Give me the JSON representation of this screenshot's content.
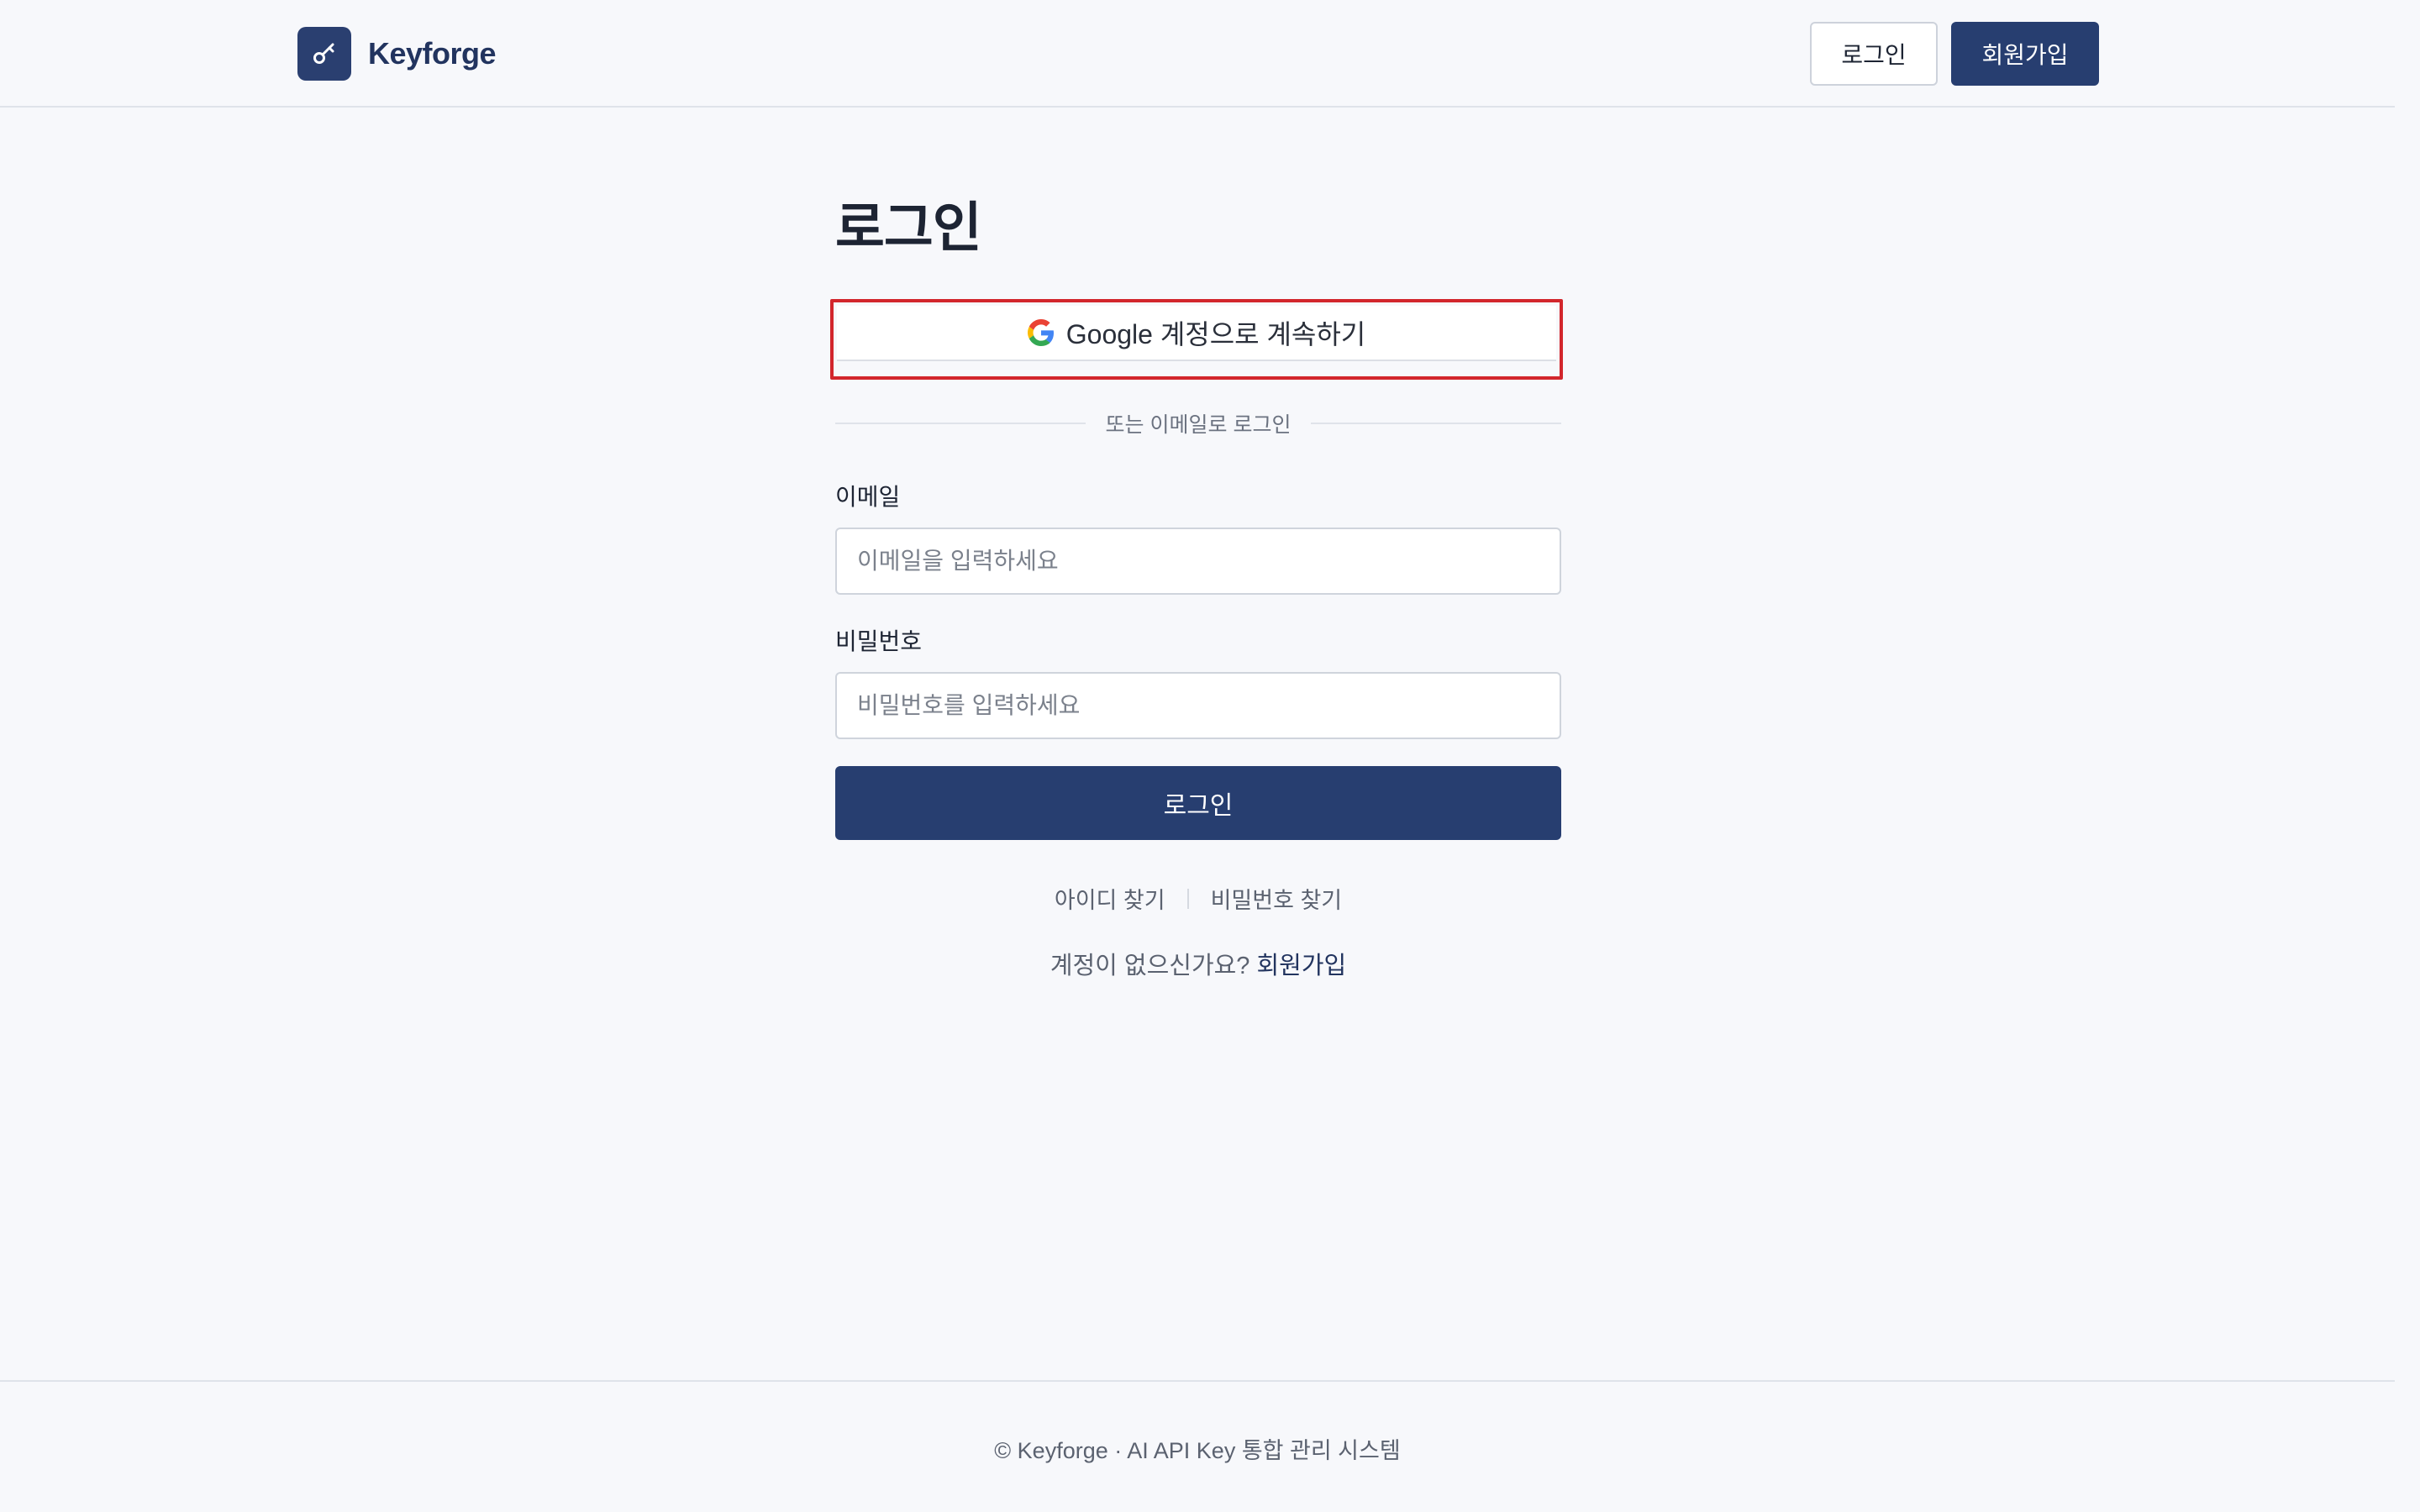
{
  "header": {
    "brand_name": "Keyforge",
    "brand_icon": "key-icon",
    "login_label": "로그인",
    "signup_label": "회원가입"
  },
  "login_form": {
    "title": "로그인",
    "google_button_label": "Google 계정으로 계속하기",
    "google_icon": "google-icon",
    "divider_text": "또는 이메일로 로그인",
    "email_label": "이메일",
    "email_placeholder": "이메일을 입력하세요",
    "email_value": "",
    "password_label": "비밀번호",
    "password_placeholder": "비밀번호를 입력하세요",
    "password_value": "",
    "submit_label": "로그인",
    "find_id_label": "아이디 찾기",
    "find_password_label": "비밀번호 찾기",
    "no_account_text": "계정이 없으신가요?",
    "signup_link_label": "회원가입"
  },
  "footer": {
    "text": "© Keyforge · AI API Key 통합 관리 시스템"
  },
  "colors": {
    "background": "#f7f8fb",
    "primary": "#273e70",
    "highlight_border": "#d2262c",
    "text": "#1d2433",
    "muted_text": "#5b6270"
  }
}
